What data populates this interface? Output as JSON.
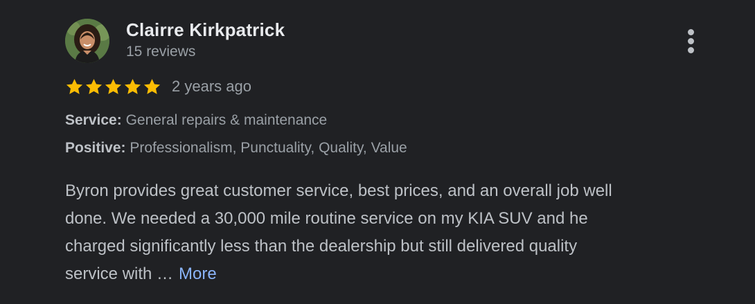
{
  "review": {
    "author": {
      "name": "Clairre Kirkpatrick",
      "review_count": "15 reviews",
      "avatar_icon": "profile-photo"
    },
    "rating": {
      "stars": 5,
      "max_stars": 5,
      "star_icon": "star-icon",
      "star_color": "#fbbc04"
    },
    "time_ago": "2 years ago",
    "service": {
      "label": "Service:",
      "value": "General repairs & maintenance"
    },
    "positive": {
      "label": "Positive:",
      "value": "Professionalism, Punctuality, Quality, Value"
    },
    "text_lines": [
      "Byron provides great customer service, best prices, and an overall job well",
      "done. We needed a 30,000 mile routine service on my KIA SUV and he",
      "charged significantly less than the dealership but still delivered quality",
      "service with …"
    ],
    "more_label": "More",
    "menu_icon": "more-vert-icon"
  },
  "colors": {
    "background": "#202124",
    "primary_text": "#e8eaed",
    "secondary_text": "#9aa0a6",
    "link": "#8ab4f8"
  }
}
